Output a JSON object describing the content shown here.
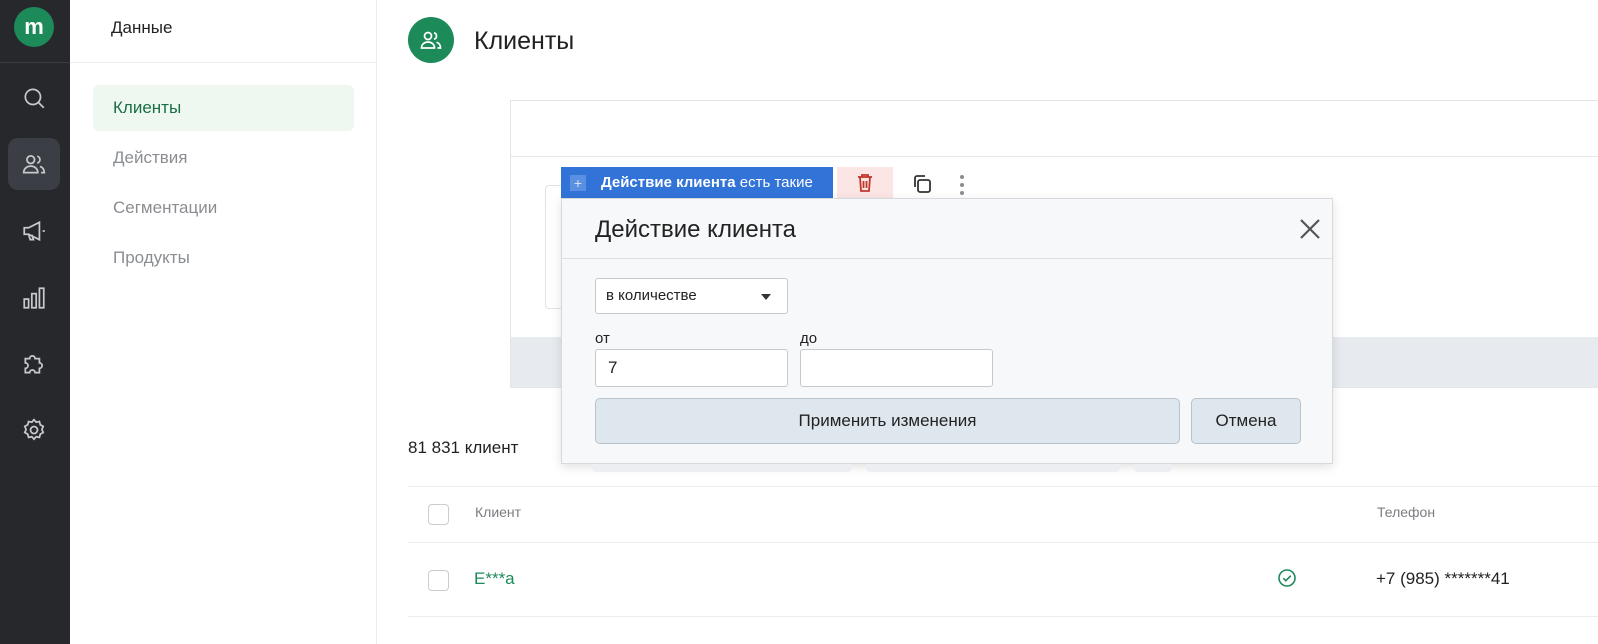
{
  "rail": {
    "logo_letter": "m",
    "items": [
      {
        "icon": "search-icon"
      },
      {
        "icon": "users-icon",
        "active": true
      },
      {
        "icon": "megaphone-icon"
      },
      {
        "icon": "bar-chart-icon"
      },
      {
        "icon": "puzzle-icon"
      },
      {
        "icon": "gear-icon"
      }
    ]
  },
  "sidebar": {
    "title": "Данные",
    "items": [
      {
        "label": "Клиенты",
        "active": true
      },
      {
        "label": "Действия"
      },
      {
        "label": "Сегментации"
      },
      {
        "label": "Продукты"
      }
    ]
  },
  "header": {
    "title": "Клиенты",
    "icon": "users-icon"
  },
  "condition": {
    "chip_bold": "Действие клиента",
    "chip_rest": " есть такие",
    "plus_glyph": "+",
    "delete_icon": "trash-icon",
    "copy_icon": "copy-icon",
    "more_icon": "more-vertical-icon"
  },
  "popup": {
    "title": "Действие клиента",
    "mode_value": "в количестве",
    "from_label": "от",
    "to_label": "до",
    "from_value": "7",
    "to_value": "",
    "apply_label": "Применить изменения",
    "cancel_label": "Отмена"
  },
  "results": {
    "count": "81 831 клиент",
    "columns": {
      "client": "Клиент",
      "phone": "Телефон"
    },
    "rows": [
      {
        "client": "Е***а",
        "verified": true,
        "phone": "+7 (985) *******41"
      }
    ]
  },
  "colors": {
    "brand": "#1d8a5a",
    "chip_blue": "#3273d8",
    "rail_bg": "#26282c"
  }
}
